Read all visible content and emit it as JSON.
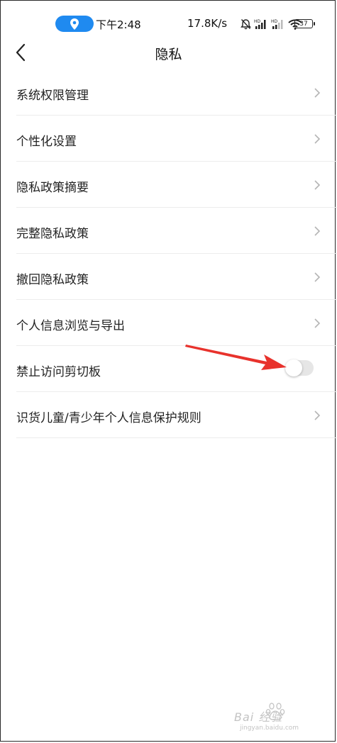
{
  "status_bar": {
    "time": "下午2:48",
    "speed": "17.8K/s",
    "battery": "37"
  },
  "header": {
    "title": "隐私"
  },
  "menu": {
    "items": [
      {
        "label": "系统权限管理",
        "control": "chevron"
      },
      {
        "label": "个性化设置",
        "control": "chevron"
      },
      {
        "label": "隐私政策摘要",
        "control": "chevron"
      },
      {
        "label": "完整隐私政策",
        "control": "chevron"
      },
      {
        "label": "撤回隐私政策",
        "control": "chevron"
      },
      {
        "label": "个人信息浏览与导出",
        "control": "chevron"
      },
      {
        "label": "禁止访问剪切板",
        "control": "toggle",
        "toggle_on": false
      },
      {
        "label": "识货儿童/青少年个人信息保护规则",
        "control": "chevron"
      }
    ]
  },
  "colors": {
    "accent": "#1f8af0",
    "annotation_arrow": "#e8322c"
  },
  "watermark": {
    "brand": "Bai 经验",
    "url": "jingyan.baidu.com"
  }
}
